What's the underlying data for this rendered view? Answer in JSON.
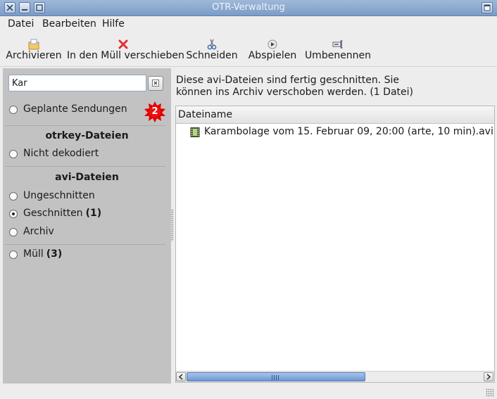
{
  "window": {
    "title": "OTR-Verwaltung"
  },
  "menubar": {
    "items": [
      {
        "label": "Datei"
      },
      {
        "label": "Bearbeiten"
      },
      {
        "label": "Hilfe"
      }
    ]
  },
  "toolbar": {
    "archive": {
      "label": "Archivieren",
      "icon": "archive-icon"
    },
    "trash": {
      "label": "In den Müll verschieben",
      "icon": "red-x-icon"
    },
    "cut": {
      "label": "Schneiden",
      "icon": "scissors-icon"
    },
    "play": {
      "label": "Abspielen",
      "icon": "play-icon"
    },
    "rename": {
      "label": "Umbenennen",
      "icon": "rename-icon"
    }
  },
  "sidebar": {
    "search": {
      "value": "Kar"
    },
    "planned": {
      "label": "Geplante Sendungen",
      "badge": "2"
    },
    "otrkey_header": "otrkey-Dateien",
    "not_decoded": {
      "label": "Nicht dekodiert"
    },
    "avi_header": "avi-Dateien",
    "uncut": {
      "label": "Ungeschnitten"
    },
    "cut": {
      "label": "Geschnitten",
      "count": "(1)",
      "selected": true
    },
    "archive": {
      "label": "Archiv"
    },
    "trash": {
      "label": "Müll",
      "count": "(3)"
    }
  },
  "main": {
    "info_line1": "Diese avi-Dateien sind fertig geschnitten. Sie",
    "info_line2": "können ins Archiv verschoben werden. (1 Datei)",
    "column_header": "Dateiname",
    "files": [
      {
        "name": "Karambolage vom 15. Februar 09, 20:00 (arte, 10 min).avi",
        "icon": "film-icon"
      }
    ]
  },
  "colors": {
    "titlebar": "#7b9cc8",
    "sidebar_bg": "#c2c2c2",
    "badge_red": "#e00000",
    "scroll_thumb": "#6e97d2"
  }
}
